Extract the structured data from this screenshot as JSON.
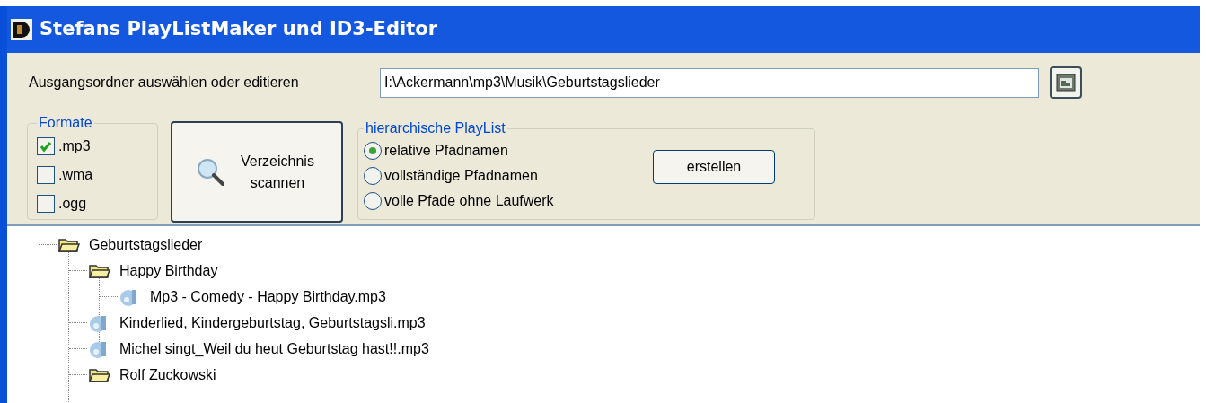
{
  "window": {
    "title": "Stefans PlayListMaker und ID3-Editor"
  },
  "source_folder": {
    "label": "Ausgangsordner auswählen oder editieren",
    "value": "I:\\Ackermann\\mp3\\Musik\\Geburtstagslieder"
  },
  "formats": {
    "title": "Formate",
    "items": [
      {
        "label": ".mp3",
        "checked": true
      },
      {
        "label": ".wma",
        "checked": false
      },
      {
        "label": ".ogg",
        "checked": false
      }
    ]
  },
  "scan_button": {
    "label": "Verzeichnis scannen"
  },
  "playlist": {
    "title": "hierarchische PlayList",
    "options": [
      {
        "label": "relative Pfadnamen",
        "selected": true
      },
      {
        "label": "vollständige Pfadnamen",
        "selected": false
      },
      {
        "label": "volle Pfade ohne Laufwerk",
        "selected": false
      }
    ],
    "button": "erstellen"
  },
  "tree": [
    {
      "kind": "folder",
      "label": "Geburtstagslieder",
      "children": [
        {
          "kind": "folder",
          "label": "Happy Birthday",
          "children": [
            {
              "kind": "file",
              "label": "Mp3 - Comedy - Happy Birthday.mp3"
            }
          ]
        },
        {
          "kind": "file",
          "label": "Kinderlied, Kindergeburtstag, Geburtstagsli.mp3"
        },
        {
          "kind": "file",
          "label": "Michel singt_Weil du heut Geburtstag hast!!.mp3"
        },
        {
          "kind": "folder",
          "label": "Rolf Zuckowski"
        }
      ]
    }
  ]
}
